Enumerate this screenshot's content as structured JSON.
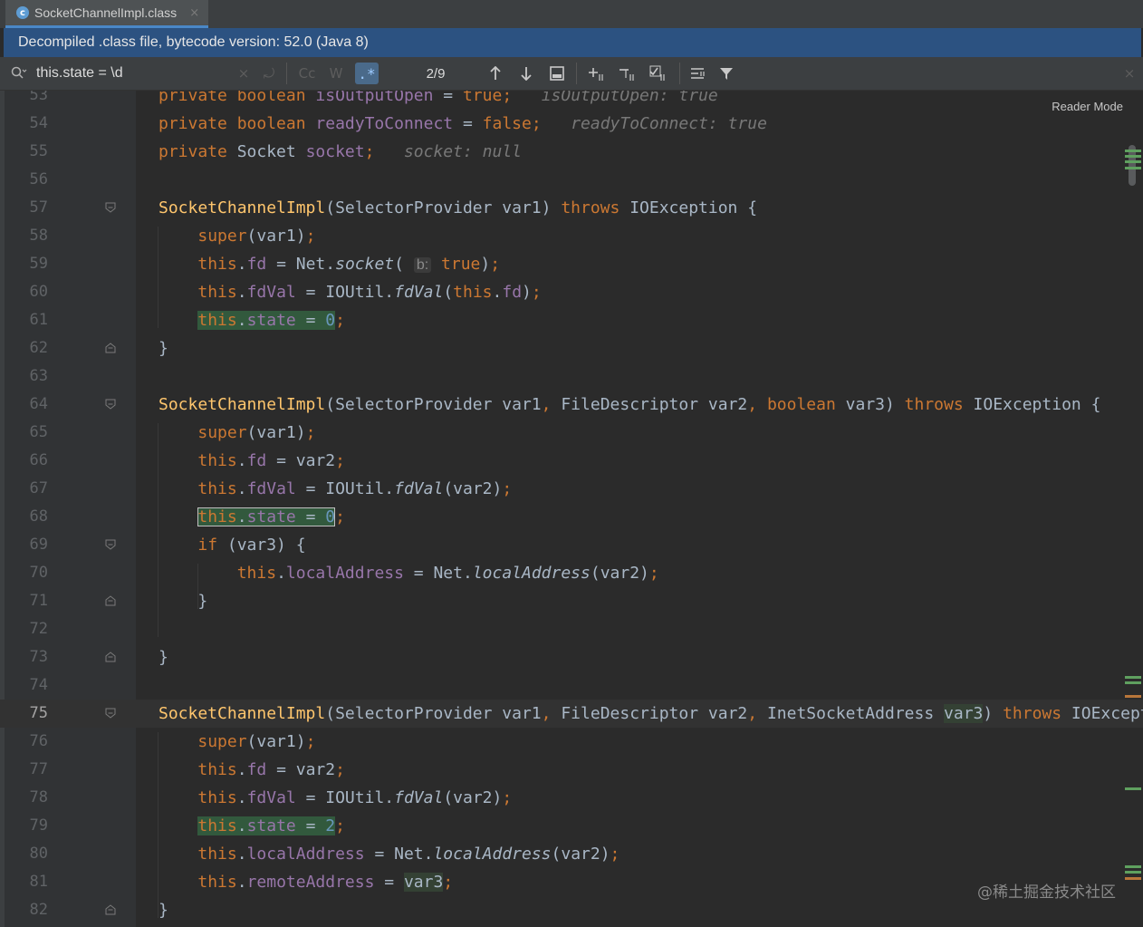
{
  "tab": {
    "icon_label": "c",
    "title": "SocketChannelImpl.class",
    "close": "×"
  },
  "banner": {
    "text": "Decompiled .class file, bytecode version: 52.0 (Java 8)"
  },
  "search": {
    "query": "this.state = \\d",
    "clear": "×",
    "history": "⤾",
    "case_label": "Cc",
    "words_label": "W",
    "regex_label": ".*",
    "match_counter": "2/9",
    "close": "×"
  },
  "reader_mode": "Reader Mode",
  "watermark": "@稀土掘金技术社区",
  "editor": {
    "current_line": "75",
    "lines": [
      {
        "n": "53",
        "parts": [
          [
            "kw",
            "private "
          ],
          [
            "kw",
            "boolean "
          ],
          [
            "fld",
            "isOutputOpen"
          ],
          [
            "plain",
            " = "
          ],
          [
            "kw",
            "true"
          ],
          [
            "kw",
            ";"
          ],
          [
            "plain",
            "   "
          ],
          [
            "hint",
            "isOutputOpen: true"
          ]
        ]
      },
      {
        "n": "54",
        "parts": [
          [
            "kw",
            "private "
          ],
          [
            "kw",
            "boolean "
          ],
          [
            "fld",
            "readyToConnect"
          ],
          [
            "plain",
            " = "
          ],
          [
            "kw",
            "false"
          ],
          [
            "kw",
            ";"
          ],
          [
            "plain",
            "   "
          ],
          [
            "hint",
            "readyToConnect: true"
          ]
        ]
      },
      {
        "n": "55",
        "parts": [
          [
            "kw",
            "private "
          ],
          [
            "plain",
            "Socket "
          ],
          [
            "fld",
            "socket"
          ],
          [
            "kw",
            ";"
          ],
          [
            "plain",
            "   "
          ],
          [
            "hint",
            "socket: null"
          ]
        ]
      },
      {
        "n": "56",
        "parts": []
      },
      {
        "n": "57",
        "parts": [
          [
            "fn",
            "SocketChannelImpl"
          ],
          [
            "plain",
            "(SelectorProvider var1) "
          ],
          [
            "kw",
            "throws "
          ],
          [
            "plain",
            "IOException {"
          ]
        ]
      },
      {
        "n": "58",
        "parts": [
          [
            "plain",
            "    "
          ],
          [
            "kw",
            "super"
          ],
          [
            "plain",
            "(var1)"
          ],
          [
            "kw",
            ";"
          ]
        ]
      },
      {
        "n": "59",
        "parts": [
          [
            "plain",
            "    "
          ],
          [
            "kw",
            "this"
          ],
          [
            "plain",
            "."
          ],
          [
            "fld",
            "fd"
          ],
          [
            "plain",
            " = Net."
          ],
          [
            "it",
            "socket"
          ],
          [
            "plain",
            "( "
          ],
          [
            "pinfo",
            "b:"
          ],
          [
            "plain",
            " "
          ],
          [
            "kw",
            "true"
          ],
          [
            "plain",
            ")"
          ],
          [
            "kw",
            ";"
          ]
        ]
      },
      {
        "n": "60",
        "parts": [
          [
            "plain",
            "    "
          ],
          [
            "kw",
            "this"
          ],
          [
            "plain",
            "."
          ],
          [
            "fld",
            "fdVal"
          ],
          [
            "plain",
            " = IOUtil."
          ],
          [
            "it",
            "fdVal"
          ],
          [
            "plain",
            "("
          ],
          [
            "kw",
            "this"
          ],
          [
            "plain",
            "."
          ],
          [
            "fld",
            "fd"
          ],
          [
            "plain",
            ")"
          ],
          [
            "kw",
            ";"
          ]
        ]
      },
      {
        "n": "61",
        "parts": [
          [
            "plain",
            "    "
          ],
          [
            "hlkw",
            "this"
          ],
          [
            "hlplain",
            "."
          ],
          [
            "hlfld",
            "state"
          ],
          [
            "hlplain",
            " = "
          ],
          [
            "hlnum",
            "0"
          ],
          [
            "kw",
            ";"
          ]
        ]
      },
      {
        "n": "62",
        "parts": [
          [
            "plain",
            "}"
          ]
        ]
      },
      {
        "n": "63",
        "parts": []
      },
      {
        "n": "64",
        "parts": [
          [
            "fn",
            "SocketChannelImpl"
          ],
          [
            "plain",
            "(SelectorProvider var1"
          ],
          [
            "kw",
            ", "
          ],
          [
            "plain",
            "FileDescriptor var2"
          ],
          [
            "kw",
            ", "
          ],
          [
            "kw",
            "boolean "
          ],
          [
            "plain",
            "var3) "
          ],
          [
            "kw",
            "throws "
          ],
          [
            "plain",
            "IOException {"
          ]
        ]
      },
      {
        "n": "65",
        "parts": [
          [
            "plain",
            "    "
          ],
          [
            "kw",
            "super"
          ],
          [
            "plain",
            "(var1)"
          ],
          [
            "kw",
            ";"
          ]
        ]
      },
      {
        "n": "66",
        "parts": [
          [
            "plain",
            "    "
          ],
          [
            "kw",
            "this"
          ],
          [
            "plain",
            "."
          ],
          [
            "fld",
            "fd"
          ],
          [
            "plain",
            " = var2"
          ],
          [
            "kw",
            ";"
          ]
        ]
      },
      {
        "n": "67",
        "parts": [
          [
            "plain",
            "    "
          ],
          [
            "kw",
            "this"
          ],
          [
            "plain",
            "."
          ],
          [
            "fld",
            "fdVal"
          ],
          [
            "plain",
            " = IOUtil."
          ],
          [
            "it",
            "fdVal"
          ],
          [
            "plain",
            "(var2)"
          ],
          [
            "kw",
            ";"
          ]
        ]
      },
      {
        "n": "68",
        "parts": [
          [
            "plain",
            "    "
          ],
          [
            "bxkw",
            "this"
          ],
          [
            "bxplain",
            "."
          ],
          [
            "bxfld",
            "state"
          ],
          [
            "bxplain",
            " = "
          ],
          [
            "bxnum",
            "0"
          ],
          [
            "kw",
            ";"
          ]
        ]
      },
      {
        "n": "69",
        "parts": [
          [
            "plain",
            "    "
          ],
          [
            "kw",
            "if "
          ],
          [
            "plain",
            "(var3) {"
          ]
        ]
      },
      {
        "n": "70",
        "parts": [
          [
            "plain",
            "        "
          ],
          [
            "kw",
            "this"
          ],
          [
            "plain",
            "."
          ],
          [
            "fld",
            "localAddress"
          ],
          [
            "plain",
            " = Net."
          ],
          [
            "it",
            "localAddress"
          ],
          [
            "plain",
            "(var2)"
          ],
          [
            "kw",
            ";"
          ]
        ]
      },
      {
        "n": "71",
        "parts": [
          [
            "plain",
            "    }"
          ]
        ]
      },
      {
        "n": "72",
        "parts": []
      },
      {
        "n": "73",
        "parts": [
          [
            "plain",
            "}"
          ]
        ]
      },
      {
        "n": "74",
        "parts": []
      },
      {
        "n": "75",
        "parts": [
          [
            "fn",
            "SocketChannelImpl"
          ],
          [
            "plain",
            "(SelectorProvider var1"
          ],
          [
            "kw",
            ", "
          ],
          [
            "plain",
            "FileDescriptor var2"
          ],
          [
            "kw",
            ", "
          ],
          [
            "plain",
            "InetSocketAddress "
          ],
          [
            "cursel",
            "var3"
          ],
          [
            "plain",
            ") "
          ],
          [
            "kw",
            "throws "
          ],
          [
            "plain",
            "IOException {"
          ]
        ]
      },
      {
        "n": "76",
        "parts": [
          [
            "plain",
            "    "
          ],
          [
            "kw",
            "super"
          ],
          [
            "plain",
            "(var1)"
          ],
          [
            "kw",
            ";"
          ]
        ]
      },
      {
        "n": "77",
        "parts": [
          [
            "plain",
            "    "
          ],
          [
            "kw",
            "this"
          ],
          [
            "plain",
            "."
          ],
          [
            "fld",
            "fd"
          ],
          [
            "plain",
            " = var2"
          ],
          [
            "kw",
            ";"
          ]
        ]
      },
      {
        "n": "78",
        "parts": [
          [
            "plain",
            "    "
          ],
          [
            "kw",
            "this"
          ],
          [
            "plain",
            "."
          ],
          [
            "fld",
            "fdVal"
          ],
          [
            "plain",
            " = IOUtil."
          ],
          [
            "it",
            "fdVal"
          ],
          [
            "plain",
            "(var2)"
          ],
          [
            "kw",
            ";"
          ]
        ]
      },
      {
        "n": "79",
        "parts": [
          [
            "plain",
            "    "
          ],
          [
            "hlkw",
            "this"
          ],
          [
            "hlplain",
            "."
          ],
          [
            "hlfld",
            "state"
          ],
          [
            "hlplain",
            " = "
          ],
          [
            "hlnum",
            "2"
          ],
          [
            "kw",
            ";"
          ]
        ]
      },
      {
        "n": "80",
        "parts": [
          [
            "plain",
            "    "
          ],
          [
            "kw",
            "this"
          ],
          [
            "plain",
            "."
          ],
          [
            "fld",
            "localAddress"
          ],
          [
            "plain",
            " = Net."
          ],
          [
            "it",
            "localAddress"
          ],
          [
            "plain",
            "(var2)"
          ],
          [
            "kw",
            ";"
          ]
        ]
      },
      {
        "n": "81",
        "parts": [
          [
            "plain",
            "    "
          ],
          [
            "kw",
            "this"
          ],
          [
            "plain",
            "."
          ],
          [
            "fld",
            "remoteAddress"
          ],
          [
            "plain",
            " = "
          ],
          [
            "cursel",
            "var3"
          ],
          [
            "kw",
            ";"
          ]
        ]
      },
      {
        "n": "82",
        "parts": [
          [
            "plain",
            "}"
          ]
        ]
      }
    ]
  }
}
